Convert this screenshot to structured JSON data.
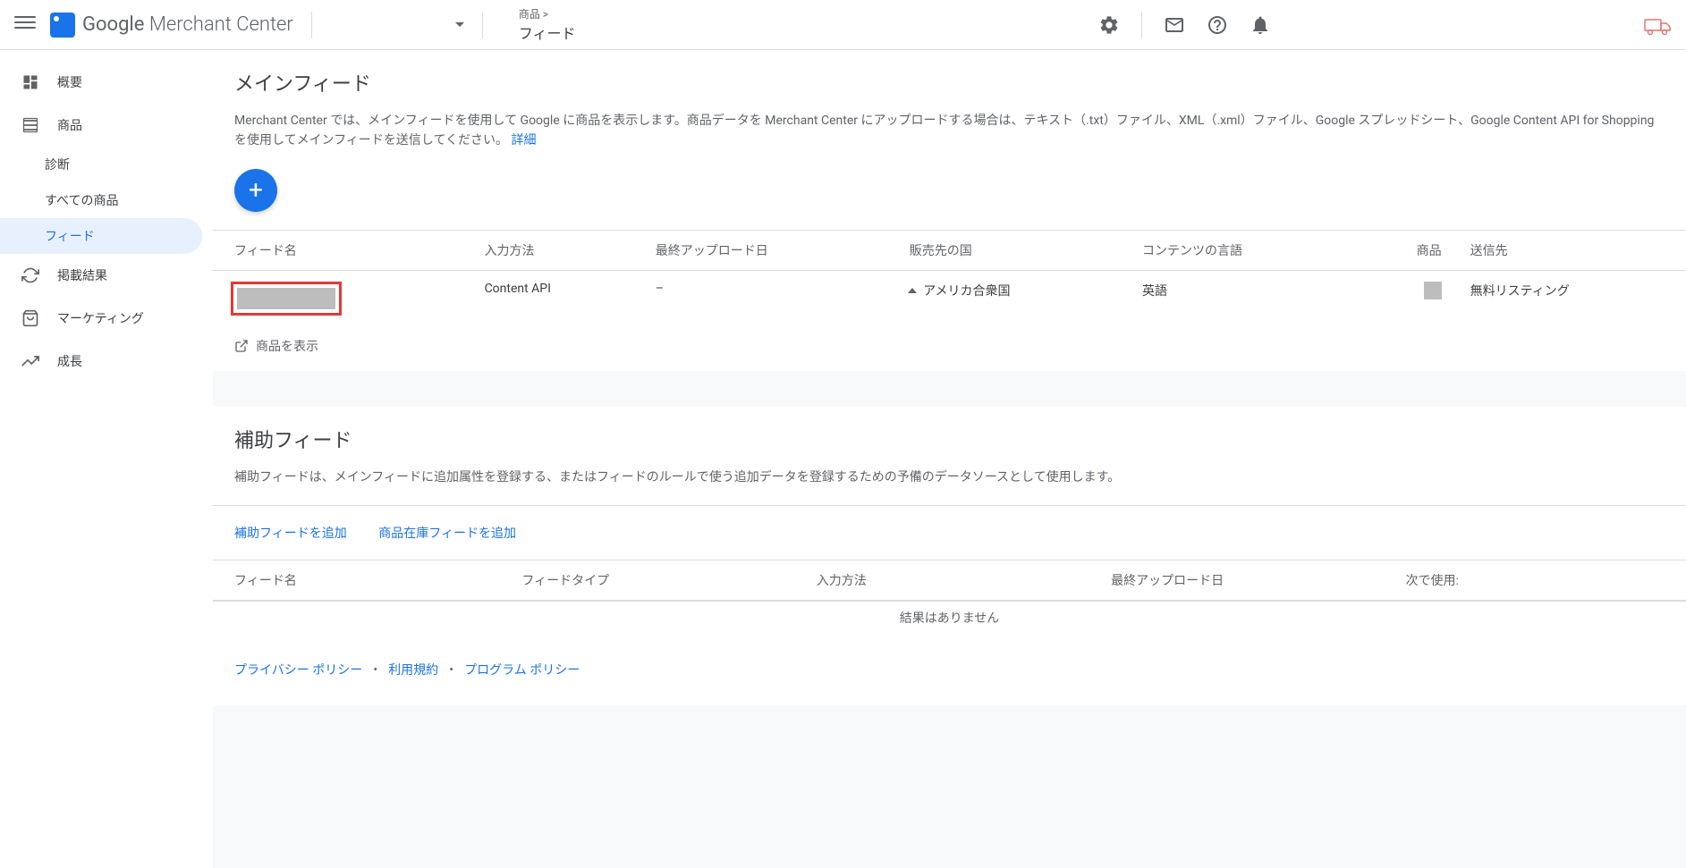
{
  "header": {
    "logo_google": "Google",
    "logo_mc": " Merchant Center",
    "breadcrumb_parent": "商品 >",
    "breadcrumb_current": "フィード"
  },
  "sidebar": {
    "items": [
      {
        "label": "概要",
        "icon": "dashboard"
      },
      {
        "label": "商品",
        "icon": "products",
        "sub": [
          {
            "label": "診断"
          },
          {
            "label": "すべての商品"
          },
          {
            "label": "フィード",
            "active": true
          }
        ]
      },
      {
        "label": "掲載結果",
        "icon": "performance"
      },
      {
        "label": "マーケティング",
        "icon": "marketing"
      },
      {
        "label": "成長",
        "icon": "growth"
      }
    ]
  },
  "main_feed": {
    "title": "メインフィード",
    "description": "Merchant Center では、メインフィードを使用して Google に商品を表示します。商品データを Merchant Center にアップロードする場合は、テキスト（.txt）ファイル、XML（.xml）ファイル、Google スプレッドシート、Google Content API for Shopping を使用してメインフィードを送信してください。 ",
    "learn_more": "詳細",
    "columns": {
      "feed_name": "フィード名",
      "input_method": "入力方法",
      "last_upload": "最終アップロード日",
      "country": "販売先の国",
      "language": "コンテンツの言語",
      "products": "商品",
      "destination": "送信先"
    },
    "row": {
      "input_method": "Content API",
      "last_upload": "–",
      "country": "アメリカ合衆国",
      "language": "英語",
      "destination": "無料リスティング"
    },
    "view_products": "商品を表示"
  },
  "sub_feed": {
    "title": "補助フィード",
    "description": "補助フィードは、メインフィードに追加属性を登録する、またはフィードのルールで使う追加データを登録するための予備のデータソースとして使用します。",
    "add_sub_feed": "補助フィードを追加",
    "add_inventory_feed": "商品在庫フィードを追加",
    "columns": {
      "feed_name": "フィード名",
      "feed_type": "フィードタイプ",
      "input_method": "入力方法",
      "last_upload": "最終アップロード日",
      "used_in": "次で使用:"
    },
    "no_results": "結果はありません"
  },
  "footer": {
    "privacy": "プライバシー ポリシー",
    "terms": "利用規約",
    "program": "プログラム ポリシー"
  }
}
